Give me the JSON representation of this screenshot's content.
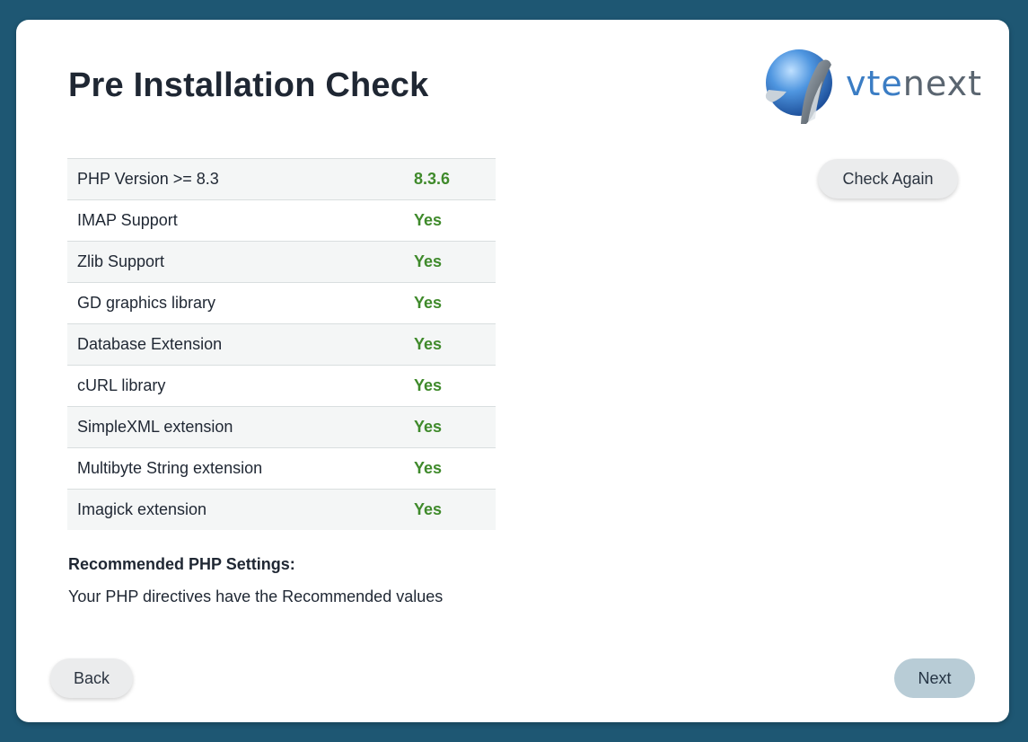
{
  "page": {
    "title": "Pre Installation Check"
  },
  "logo": {
    "text_part1": "vte",
    "text_part2": "next",
    "colors": {
      "primary": "#3b7dc4",
      "secondary": "#5a6570"
    }
  },
  "checks": [
    {
      "label": "PHP Version >= 8.3",
      "value": "8.3.6"
    },
    {
      "label": "IMAP Support",
      "value": "Yes"
    },
    {
      "label": "Zlib Support",
      "value": "Yes"
    },
    {
      "label": "GD graphics library",
      "value": "Yes"
    },
    {
      "label": "Database Extension",
      "value": "Yes"
    },
    {
      "label": "cURL library",
      "value": "Yes"
    },
    {
      "label": "SimpleXML extension",
      "value": "Yes"
    },
    {
      "label": "Multibyte String extension",
      "value": "Yes"
    },
    {
      "label": "Imagick extension",
      "value": "Yes"
    }
  ],
  "recommended": {
    "heading": "Recommended PHP Settings:",
    "text": "Your PHP directives have the Recommended values"
  },
  "buttons": {
    "check_again": "Check Again",
    "back": "Back",
    "next": "Next"
  },
  "colors": {
    "background": "#1e5773",
    "success": "#3f8a2b",
    "next_button": "#b8ccd6"
  }
}
